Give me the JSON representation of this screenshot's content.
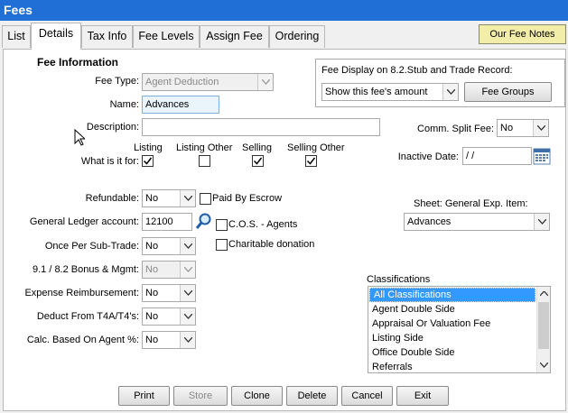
{
  "window": {
    "title": "Fees"
  },
  "tabs": [
    {
      "label": "List"
    },
    {
      "label": "Details"
    },
    {
      "label": "Tax Info"
    },
    {
      "label": "Fee Levels"
    },
    {
      "label": "Assign Fee"
    },
    {
      "label": "Ordering"
    }
  ],
  "our_fee_notes": "Our Fee Notes",
  "fee_info": {
    "section_title": "Fee Information",
    "fee_type_label": "Fee Type:",
    "fee_type_value": "Agent Deduction",
    "name_label": "Name:",
    "name_value": "Advances",
    "description_label": "Description:",
    "description_value": "",
    "what_label": "What is it for:",
    "for_options": [
      {
        "label": "Listing",
        "checked": true
      },
      {
        "label": "Listing Other",
        "checked": false
      },
      {
        "label": "Selling",
        "checked": true
      },
      {
        "label": "Selling Other",
        "checked": true
      }
    ]
  },
  "fee_display": {
    "label": "Fee Display on 8.2.Stub and Trade Record:",
    "value": "Show this fee's amount",
    "fee_groups_button": "Fee Groups"
  },
  "comm_split": {
    "label": "Comm. Split Fee:",
    "value": "No"
  },
  "inactive_date": {
    "label": "Inactive Date:",
    "value": " / /"
  },
  "refundable": {
    "label": "Refundable:",
    "value": "No"
  },
  "paid_by_escrow": {
    "label": "Paid By Escrow",
    "checked": false
  },
  "gl_account": {
    "label": "General Ledger account:",
    "value": "12100"
  },
  "cos_agents": {
    "label": "C.O.S. - Agents",
    "checked": false
  },
  "charitable": {
    "label": "Charitable donation",
    "checked": false
  },
  "once_per_subtrade": {
    "label": "Once Per Sub-Trade:",
    "value": "No"
  },
  "bonus_mgmt": {
    "label": "9.1 / 8.2 Bonus & Mgmt:",
    "value": "No"
  },
  "expense_reimb": {
    "label": "Expense Reimbursement:",
    "value": "No"
  },
  "deduct_t4a": {
    "label": "Deduct From T4A/T4's:",
    "value": "No"
  },
  "calc_agent_pct": {
    "label": "Calc. Based On Agent %:",
    "value": "No"
  },
  "sheet_item": {
    "label": "Sheet: General Exp. Item:",
    "value": "Advances"
  },
  "classifications": {
    "label": "Classifications",
    "items": [
      "All Classifications",
      "Agent Double Side",
      "Appraisal Or Valuation Fee",
      "Listing Side",
      "Office Double Side",
      "Referrals"
    ],
    "selected_index": 0
  },
  "buttons": {
    "print": "Print",
    "store": "Store",
    "clone": "Clone",
    "delete": "Delete",
    "cancel": "Cancel",
    "exit": "Exit"
  }
}
